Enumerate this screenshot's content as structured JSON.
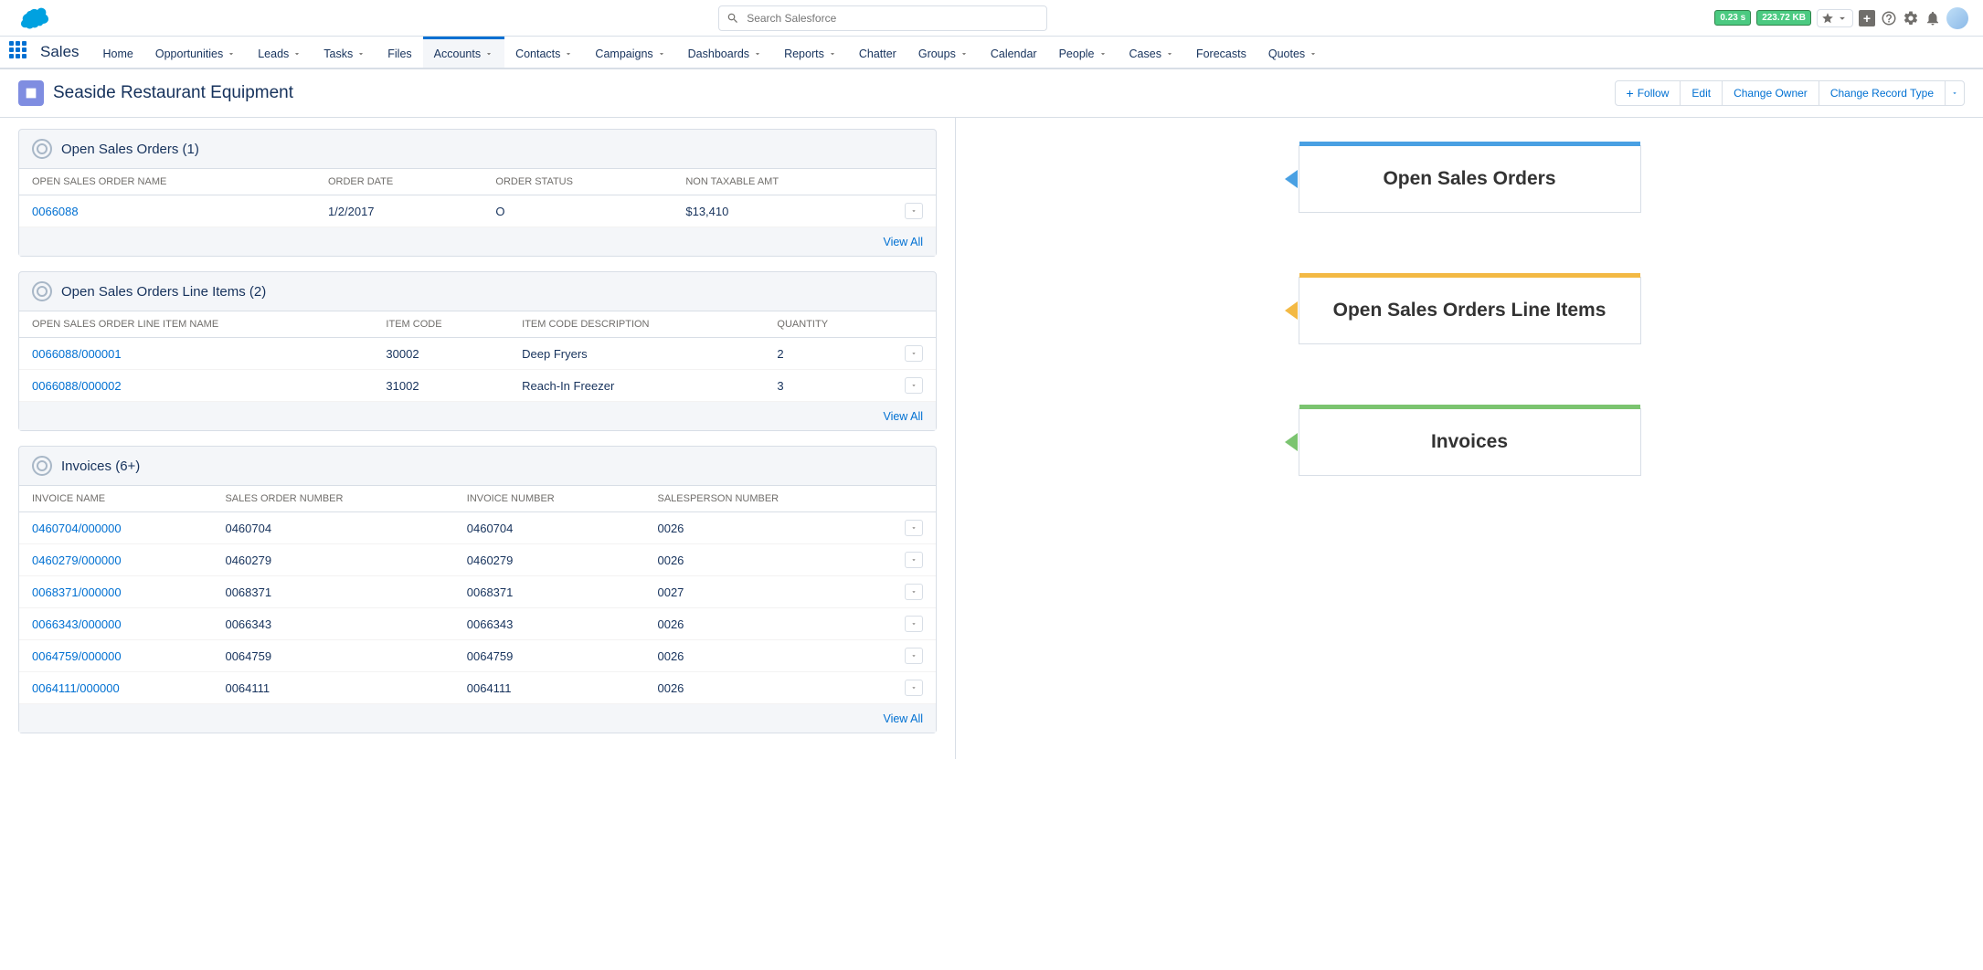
{
  "search": {
    "placeholder": "Search Salesforce"
  },
  "perf": {
    "time": "0.23 s",
    "size": "223.72 KB"
  },
  "app_name": "Sales",
  "nav": [
    "Home",
    "Opportunities",
    "Leads",
    "Tasks",
    "Files",
    "Accounts",
    "Contacts",
    "Campaigns",
    "Dashboards",
    "Reports",
    "Chatter",
    "Groups",
    "Calendar",
    "People",
    "Cases",
    "Forecasts",
    "Quotes"
  ],
  "nav_has_dropdown": [
    false,
    true,
    true,
    true,
    false,
    true,
    true,
    true,
    true,
    true,
    false,
    true,
    false,
    true,
    true,
    false,
    true
  ],
  "nav_active_index": 5,
  "record": {
    "title": "Seaside Restaurant Equipment",
    "actions": {
      "follow": "Follow",
      "edit": "Edit",
      "change_owner": "Change Owner",
      "change_record_type": "Change Record Type"
    }
  },
  "view_all": "View All",
  "cards": {
    "open_sales_orders": {
      "title": "Open Sales Orders (1)",
      "columns": [
        "OPEN SALES ORDER NAME",
        "ORDER DATE",
        "ORDER STATUS",
        "NON TAXABLE AMT"
      ],
      "rows": [
        {
          "name": "0066088",
          "date": "1/2/2017",
          "status": "O",
          "amt": "$13,410"
        }
      ]
    },
    "line_items": {
      "title": "Open Sales Orders Line Items (2)",
      "columns": [
        "OPEN SALES ORDER LINE ITEM NAME",
        "ITEM CODE",
        "ITEM CODE DESCRIPTION",
        "QUANTITY"
      ],
      "rows": [
        {
          "name": "0066088/000001",
          "code": "30002",
          "desc": "Deep Fryers",
          "qty": "2"
        },
        {
          "name": "0066088/000002",
          "code": "31002",
          "desc": "Reach-In Freezer",
          "qty": "3"
        }
      ]
    },
    "invoices": {
      "title": "Invoices (6+)",
      "columns": [
        "INVOICE NAME",
        "SALES ORDER NUMBER",
        "INVOICE NUMBER",
        "SALESPERSON NUMBER"
      ],
      "rows": [
        {
          "name": "0460704/000000",
          "so": "0460704",
          "inv": "0460704",
          "sp": "0026"
        },
        {
          "name": "0460279/000000",
          "so": "0460279",
          "inv": "0460279",
          "sp": "0026"
        },
        {
          "name": "0068371/000000",
          "so": "0068371",
          "inv": "0068371",
          "sp": "0027"
        },
        {
          "name": "0066343/000000",
          "so": "0066343",
          "inv": "0066343",
          "sp": "0026"
        },
        {
          "name": "0064759/000000",
          "so": "0064759",
          "inv": "0064759",
          "sp": "0026"
        },
        {
          "name": "0064111/000000",
          "so": "0064111",
          "inv": "0064111",
          "sp": "0026"
        }
      ]
    }
  },
  "callouts": {
    "blue": "Open Sales Orders",
    "yellow": "Open Sales Orders Line Items",
    "green": "Invoices"
  }
}
